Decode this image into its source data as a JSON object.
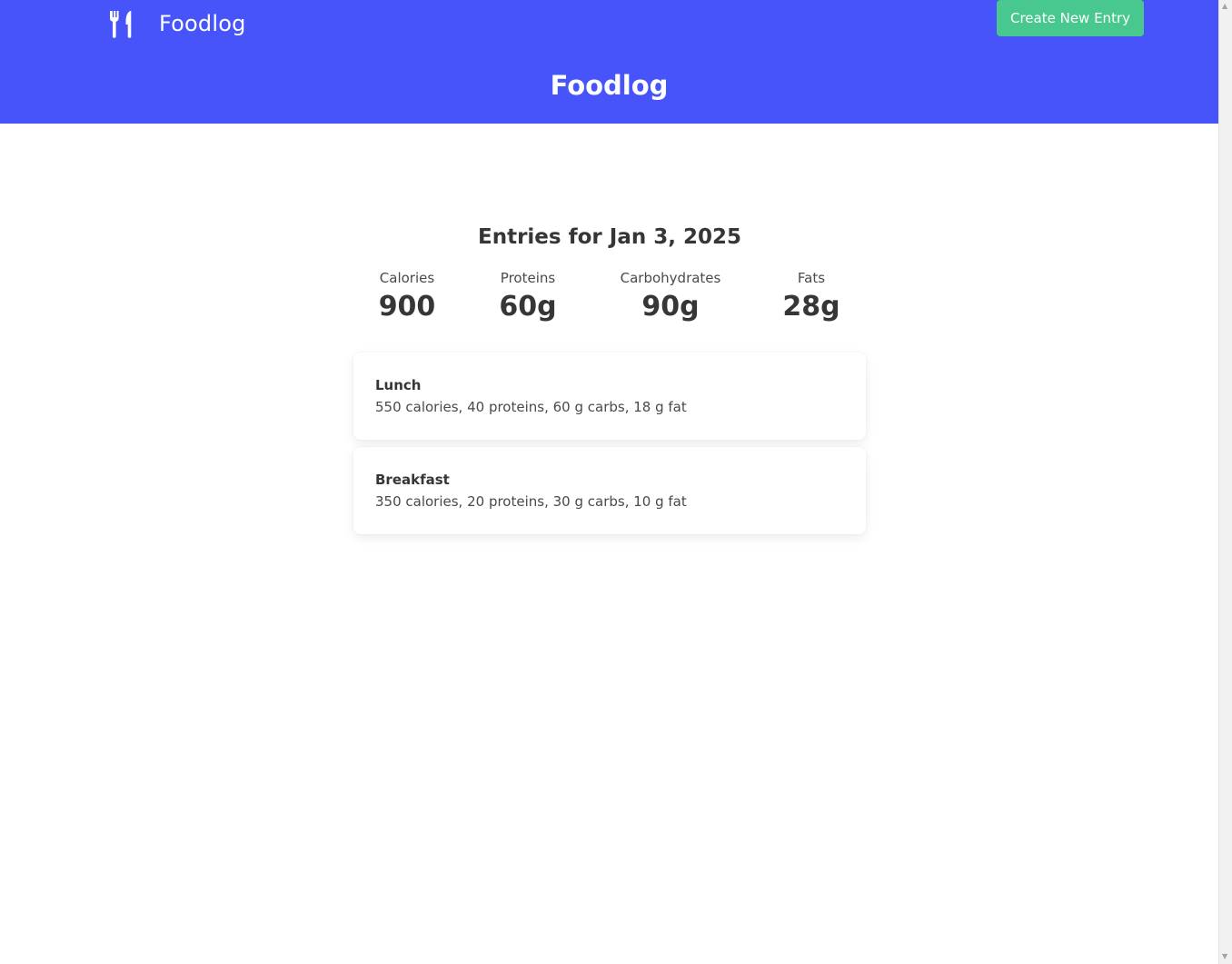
{
  "navbar": {
    "brand_icon": "utensils-icon",
    "brand_name": "Foodlog",
    "create_button_label": "Create New Entry"
  },
  "hero": {
    "title": "Foodlog"
  },
  "summary": {
    "title": "Entries for Jan 3, 2025",
    "stats": [
      {
        "label": "Calories",
        "value": "900"
      },
      {
        "label": "Proteins",
        "value": "60g"
      },
      {
        "label": "Carbohydrates",
        "value": "90g"
      },
      {
        "label": "Fats",
        "value": "28g"
      }
    ]
  },
  "entries": [
    {
      "name": "Lunch",
      "details": "550 calories, 40 proteins, 60 g carbs, 18 g fat"
    },
    {
      "name": "Breakfast",
      "details": "350 calories, 20 proteins, 30 g carbs, 10 g fat"
    }
  ],
  "colors": {
    "primary": "#4654fa",
    "success": "#48c78e",
    "text": "#363636"
  }
}
